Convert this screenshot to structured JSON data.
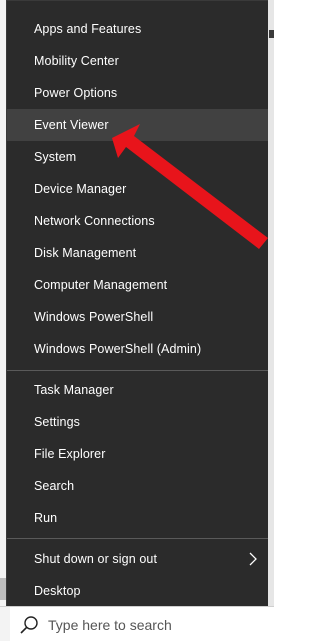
{
  "menu": {
    "items": [
      {
        "label": "Apps and Features"
      },
      {
        "label": "Mobility Center"
      },
      {
        "label": "Power Options"
      },
      {
        "label": "Event Viewer",
        "hover": true
      },
      {
        "label": "System"
      },
      {
        "label": "Device Manager"
      },
      {
        "label": "Network Connections"
      },
      {
        "label": "Disk Management"
      },
      {
        "label": "Computer Management"
      },
      {
        "label": "Windows PowerShell"
      },
      {
        "label": "Windows PowerShell (Admin)"
      },
      {
        "label": "Task Manager"
      },
      {
        "label": "Settings"
      },
      {
        "label": "File Explorer"
      },
      {
        "label": "Search"
      },
      {
        "label": "Run"
      },
      {
        "label": "Shut down or sign out",
        "submenu": true
      },
      {
        "label": "Desktop"
      }
    ]
  },
  "taskbar": {
    "search_placeholder": "Type here to search",
    "search_icon": "search-icon"
  },
  "annotation": {
    "arrow_color": "#e8141b",
    "points_to": "Event Viewer"
  },
  "colors": {
    "menu_bg": "#2b2b2b",
    "hover_bg": "#414141",
    "text": "#ffffff",
    "separator": "#5a5a5a"
  }
}
